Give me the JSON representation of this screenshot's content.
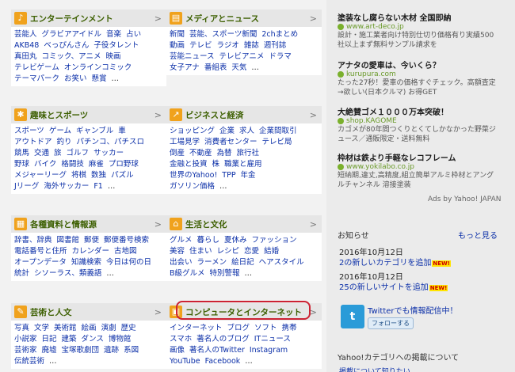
{
  "categories": [
    {
      "id": "entertainment",
      "title": "エンターテインメント",
      "icon": "♪",
      "lines": [
        [
          "芸能人",
          "グラビアアイドル",
          "音楽",
          "占い"
        ],
        [
          "AKB48",
          "べっぴんさん",
          "子役タレント"
        ],
        [
          "真田丸",
          "コミック、アニメ",
          "映画"
        ],
        [
          "テレビゲーム",
          "オンラインコミック"
        ],
        [
          "テーマパーク",
          "お笑い",
          "懸賞",
          "…"
        ]
      ]
    },
    {
      "id": "media",
      "title": "メディアとニュース",
      "icon": "▤",
      "lines": [
        [
          "新聞",
          "芸能、スポーツ新聞",
          "2chまとめ"
        ],
        [
          "動画",
          "テレビ",
          "ラジオ",
          "雑誌",
          "週刊誌"
        ],
        [
          "芸能ニュース",
          "テレビアニメ",
          "ドラマ"
        ],
        [
          "女子アナ",
          "番組表",
          "天気",
          "…"
        ]
      ]
    },
    {
      "id": "sports",
      "title": "趣味とスポーツ",
      "icon": "✱",
      "lines": [
        [
          "スポーツ",
          "ゲーム",
          "ギャンブル",
          "車"
        ],
        [
          "アウトドア",
          "釣り",
          "パチンコ、パチスロ"
        ],
        [
          "競馬",
          "交通",
          "旅",
          "ゴルフ",
          "サッカー"
        ],
        [
          "野球",
          "バイク",
          "格闘技",
          "麻雀",
          "プロ野球"
        ],
        [
          "メジャーリーグ",
          "将棋",
          "数独",
          "パズル"
        ],
        [
          "Jリーグ",
          "海外サッカー",
          "F1",
          "…"
        ]
      ]
    },
    {
      "id": "business",
      "title": "ビジネスと経済",
      "icon": "↗",
      "lines": [
        [
          "ショッピング",
          "企業",
          "求人",
          "企業間取引"
        ],
        [
          "工場見学",
          "消費者センター",
          "テレビ局"
        ],
        [
          "倒産",
          "不動産",
          "為替",
          "旅行社"
        ],
        [
          "金融と投資",
          "株",
          "職業と雇用"
        ],
        [
          "世界のYahoo!",
          "TPP",
          "年金"
        ],
        [
          "ガソリン価格",
          "…"
        ]
      ]
    },
    {
      "id": "reference",
      "title": "各種資料と情報源",
      "icon": "▦",
      "lines": [
        [
          "辞書、辞典",
          "図書館",
          "郵便",
          "郵便番号検索"
        ],
        [
          "電話番号と住所",
          "カレンダー",
          "古地図"
        ],
        [
          "オープンデータ",
          "知識検索",
          "今日は何の日"
        ],
        [
          "統計",
          "シソーラス、類義語",
          "…"
        ]
      ]
    },
    {
      "id": "life",
      "title": "生活と文化",
      "icon": "⌂",
      "lines": [
        [
          "グルメ",
          "暮らし",
          "夏休み",
          "ファッション"
        ],
        [
          "美容",
          "住まい",
          "レシピ",
          "恋愛",
          "結婚"
        ],
        [
          "出会い",
          "ラーメン",
          "絵日記",
          "ヘアスタイル"
        ],
        [
          "B級グルメ",
          "特別警報",
          "…"
        ]
      ]
    },
    {
      "id": "arts",
      "title": "芸術と人文",
      "icon": "✎",
      "lines": [
        [
          "写真",
          "文学",
          "美術館",
          "絵画",
          "演劇",
          "歴史"
        ],
        [
          "小説家",
          "日記",
          "建築",
          "ダンス",
          "博物館"
        ],
        [
          "芸術家",
          "廃墟",
          "宝塚歌劇団",
          "遺跡",
          "系図"
        ],
        [
          "伝統芸術",
          "…"
        ]
      ]
    },
    {
      "id": "computers",
      "title": "コンピュータとインターネット",
      "icon": "▣",
      "lines": [
        [
          "インターネット",
          "ブログ",
          "ソフト",
          "携帯"
        ],
        [
          "スマホ",
          "著名人のブログ",
          "ITニュース"
        ],
        [
          "画像",
          "著名人のTwitter",
          "Instagram"
        ],
        [
          "YouTube",
          "Facebook",
          "…"
        ]
      ]
    }
  ],
  "ads": [
    {
      "title": "塗装なし腐らない木材 全国即納",
      "url": "www.art-deco.jp",
      "desc": "設計・施工業者向け特別仕切り価格有り実績500社以上まず無料サンプル請求を"
    },
    {
      "title": "アナタの愛車は、今いくら？",
      "url": "kurupura.com",
      "desc": "たった27秒！愛車の価格すぐチェック。高額査定→欲しい(日本クルマ) お得GET"
    },
    {
      "title": "大絶賛ゴメ１０００万本突破！",
      "url": "shop.KAGOME",
      "desc": "カゴメが80年間つくりとくてしかなかった野菜ジュース／通販限定・送料無料"
    },
    {
      "title": "枠材は鉄より手軽なレコフレーム",
      "url": "www.yokilabo.co.jp",
      "desc": "短納期,違丈,高精度,組立簡単アルミ枠材とアングルチャンネル 溶接塗装"
    }
  ],
  "ads_by": "Ads by Yahoo! JAPAN",
  "notice": {
    "title": "お知らせ",
    "more": "もっと見る",
    "items": [
      {
        "date": "2016年10月12日",
        "text": "2の新しいカテゴリを追加",
        "badge": "NEW!"
      },
      {
        "date": "2016年10月12日",
        "text": "25の新しいサイトを追加",
        "badge": "NEW!"
      }
    ]
  },
  "twitter": {
    "text": "Twitterでも情報配信中！",
    "follow": "フォローする"
  },
  "yahoo_box": {
    "title": "Yahoo!カテゴリへの掲載について",
    "sub": "掲載について知りたい"
  }
}
